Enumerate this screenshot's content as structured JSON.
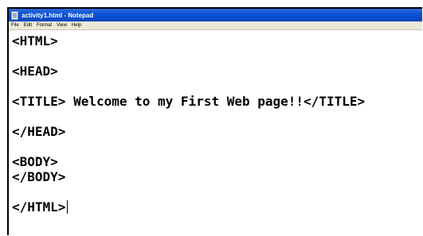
{
  "window": {
    "title": "activity1.html - Notepad"
  },
  "menu": {
    "items": [
      "File",
      "Edit",
      "Format",
      "View",
      "Help"
    ]
  },
  "editor": {
    "lines": [
      "<HTML>",
      "",
      "<HEAD>",
      "",
      "<TITLE> Welcome to my First Web page!!</TITLE>",
      "",
      "</HEAD>",
      "",
      "<BODY>",
      "</BODY>",
      "",
      "</HTML>"
    ]
  },
  "colors": {
    "titlebar": "#0b52d6",
    "menubar": "#ece9d8",
    "text": "#000000"
  },
  "icons": {
    "app": "notepad-icon"
  }
}
